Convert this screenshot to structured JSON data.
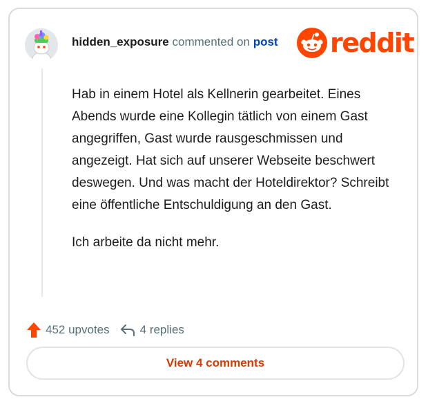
{
  "comment": {
    "username": "hidden_exposure",
    "action_text": "commented on",
    "post_link_text": "post",
    "paragraphs": [
      "Hab in einem Hotel als Kellnerin gearbeitet. Eines Abends wurde eine Kollegin tätlich von einem Gast angegriffen, Gast wurde rausgeschmissen und angezeigt. Hat sich auf unserer Webseite beschwert deswegen. Und was macht der Hoteldirektor? Schreibt eine öffentliche Entschuldigung an den Gast.",
      "Ich arbeite da nicht mehr."
    ]
  },
  "brand": {
    "wordmark": "reddit",
    "color": "#ff4500"
  },
  "footer": {
    "upvotes_text": "452 upvotes",
    "replies_text": "4 replies",
    "upvote_icon": "upvote-arrow-icon",
    "reply_icon": "reply-arrow-icon"
  },
  "button": {
    "label": "View 4 comments",
    "color": "#d93900"
  }
}
